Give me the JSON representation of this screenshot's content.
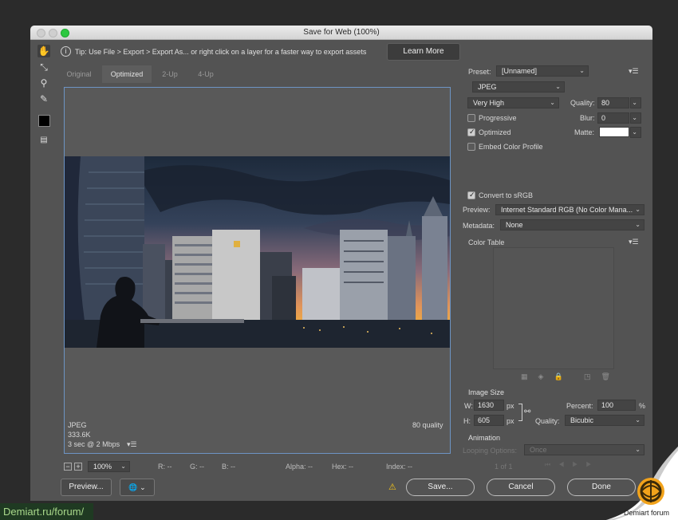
{
  "window": {
    "title": "Save for Web (100%)"
  },
  "tip": {
    "text": "Tip: Use File > Export > Export As...  or right click on a layer for a faster way to export assets",
    "learn_more": "Learn More"
  },
  "tabs": [
    "Original",
    "Optimized",
    "2-Up",
    "4-Up"
  ],
  "image_info": {
    "format": "JPEG",
    "size": "333.6K",
    "time": "3 sec @ 2 Mbps",
    "quality_note": "80 quality"
  },
  "right_panel": {
    "preset_label": "Preset:",
    "preset_value": "[Unnamed]",
    "format_value": "JPEG",
    "quality_preset": "Very High",
    "quality_label": "Quality:",
    "quality_value": "80",
    "progressive_label": "Progressive",
    "blur_label": "Blur:",
    "blur_value": "0",
    "optimized_label": "Optimized",
    "matte_label": "Matte:",
    "embed_label": "Embed Color Profile",
    "convert_label": "Convert to sRGB",
    "preview_label": "Preview:",
    "preview_value": "Internet Standard RGB (No Color Mana...",
    "metadata_label": "Metadata:",
    "metadata_value": "None",
    "color_table_label": "Color Table",
    "image_size_label": "Image Size",
    "w_label": "W:",
    "w_value": "1630",
    "h_label": "H:",
    "h_value": "605",
    "px": "px",
    "percent_label": "Percent:",
    "percent_value": "100",
    "percent_unit": "%",
    "resample_label": "Quality:",
    "resample_value": "Bicubic",
    "animation_label": "Animation",
    "looping_label": "Looping Options:",
    "looping_value": "Once",
    "frame_counter": "1 of 1"
  },
  "status_bar": {
    "zoom": "100%",
    "r": "R: --",
    "g": "G: --",
    "b": "B: --",
    "alpha": "Alpha: --",
    "hex": "Hex: --",
    "index": "Index: --"
  },
  "footer": {
    "preview_button": "Preview...",
    "save_button": "Save...",
    "cancel_button": "Cancel",
    "done_button": "Done"
  },
  "watermark": {
    "text": "Demiart.ru/forum/",
    "badge_text": "Demiart forum"
  }
}
